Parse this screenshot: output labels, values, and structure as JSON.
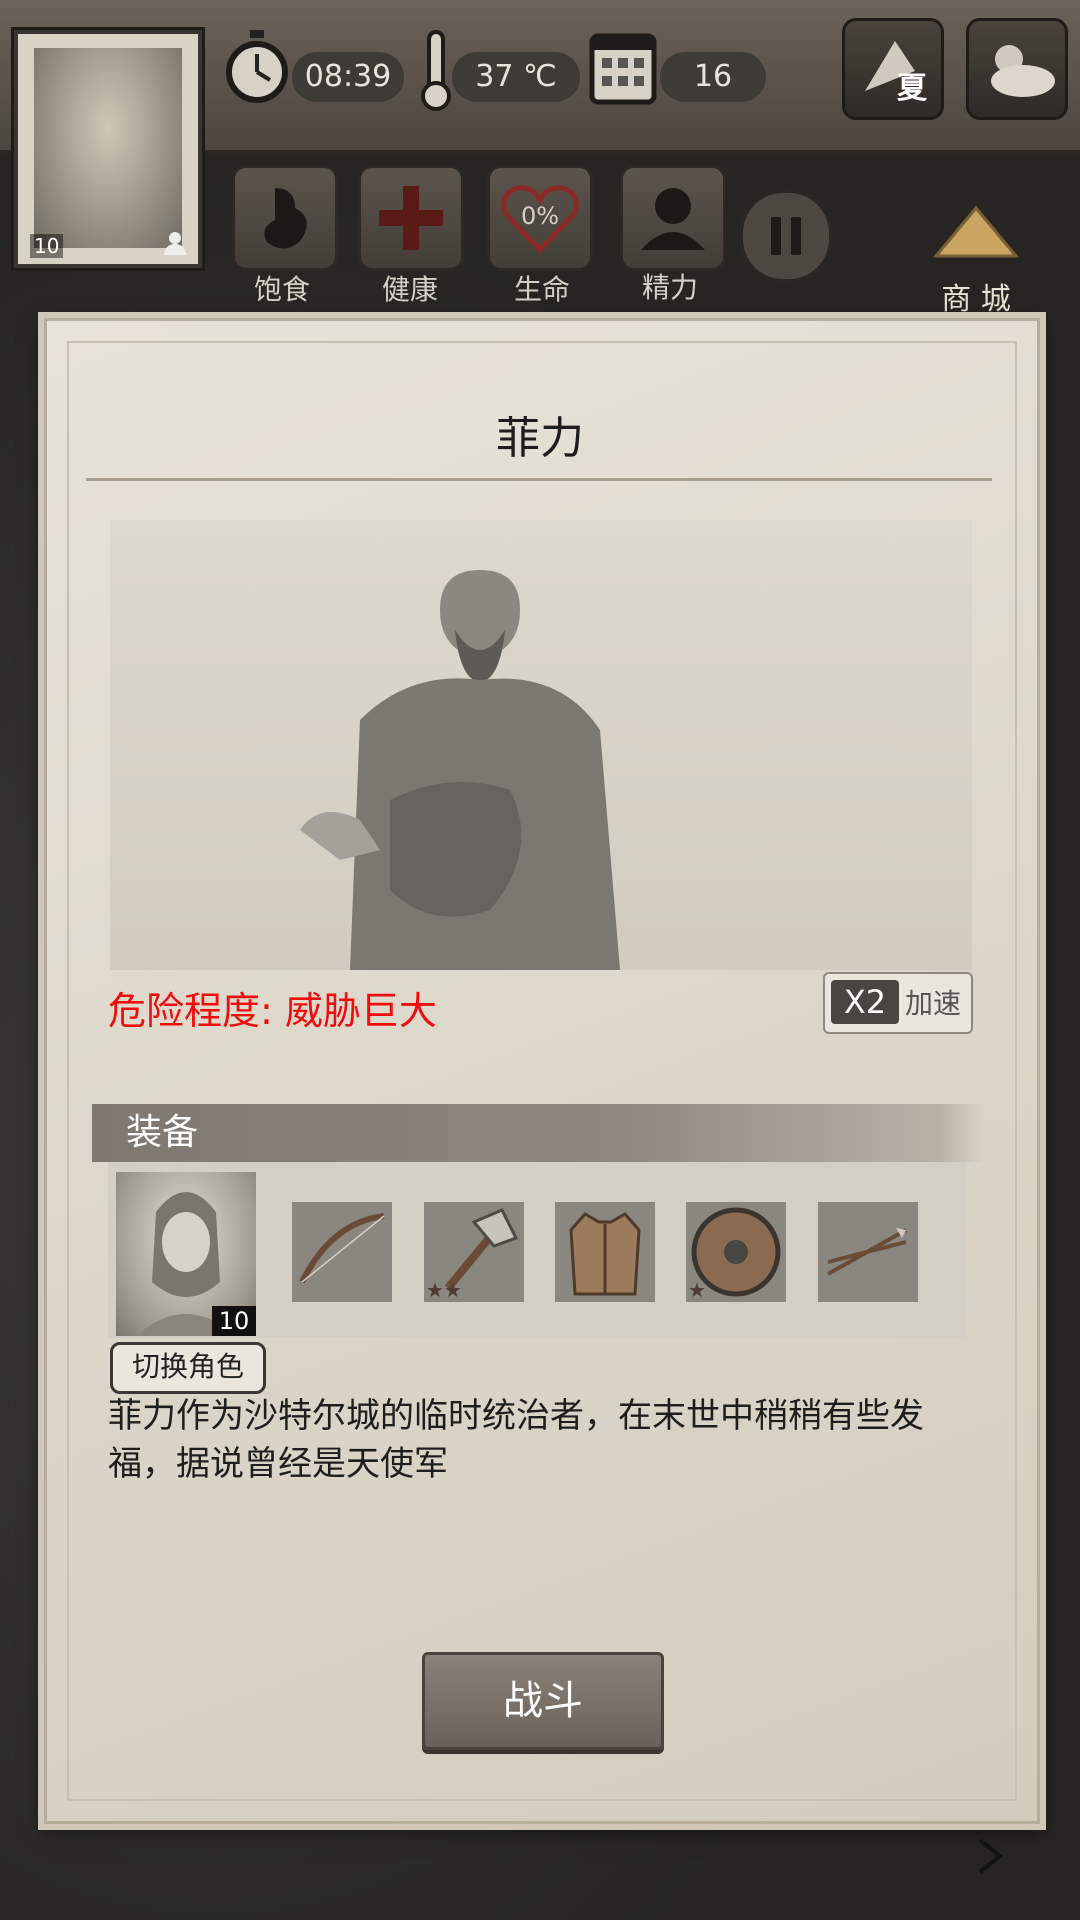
{
  "hud": {
    "time": "08:39",
    "temperature": "37 ℃",
    "day": "16",
    "season": "夏",
    "player_level": "10"
  },
  "stats": [
    {
      "label": "饱食"
    },
    {
      "label": "健康"
    },
    {
      "label": "生命",
      "value": "0%"
    },
    {
      "label": "精力"
    }
  ],
  "shop_label": "商 城",
  "dialog": {
    "title": "菲力",
    "danger_label": "危险程度: 威胁巨大",
    "speed_multiplier": "X2",
    "speed_label": "加速",
    "equipment_header": "装备",
    "hero_level": "10",
    "switch_button": "切换角色",
    "description": "菲力作为沙特尔城的临时统治者，在末世中稍稍有些发福，据说曾经是天使军",
    "fight_button": "战斗"
  },
  "equipment": [
    {
      "item": "bow",
      "stars": 0
    },
    {
      "item": "axe",
      "stars": 2
    },
    {
      "item": "leather-vest",
      "stars": 0
    },
    {
      "item": "round-shield",
      "stars": 1
    },
    {
      "item": "arrows",
      "stars": 0
    }
  ],
  "colors": {
    "danger": "#f20d0d",
    "parchment": "#e3ded3",
    "wood": "#4d4640"
  }
}
